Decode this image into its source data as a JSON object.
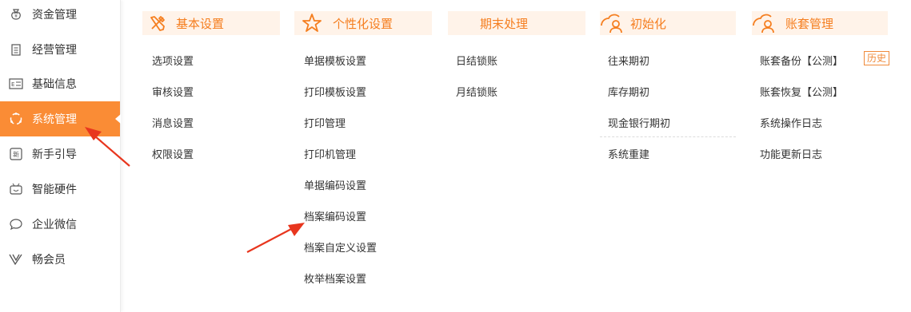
{
  "sidebar": {
    "items": [
      {
        "label": "资金管理",
        "icon": "money-bag-icon"
      },
      {
        "label": "经营管理",
        "icon": "clipboard-icon"
      },
      {
        "label": "基础信息",
        "icon": "id-card-icon"
      },
      {
        "label": "系统管理",
        "icon": "system-cycle-icon"
      },
      {
        "label": "新手引导",
        "icon": "new-badge-icon"
      },
      {
        "label": "智能硬件",
        "icon": "tv-robot-icon"
      },
      {
        "label": "企业微信",
        "icon": "chat-bubble-icon"
      },
      {
        "label": "畅会员",
        "icon": "vip-v-icon"
      }
    ],
    "active_index": 3
  },
  "columns": [
    {
      "title": "基本设置",
      "icon": "tools-icon",
      "items": [
        "选项设置",
        "审核设置",
        "消息设置",
        "权限设置"
      ]
    },
    {
      "title": "个性化设置",
      "icon": "star-icon",
      "items": [
        "单据模板设置",
        "打印模板设置",
        "打印管理",
        "打印机管理",
        "单据编码设置",
        "档案编码设置",
        "档案自定义设置",
        "枚举档案设置"
      ]
    },
    {
      "title": "期末处理",
      "icon": "",
      "items": [
        "日结锁账",
        "月结锁账"
      ]
    },
    {
      "title": "初始化",
      "icon": "cloud-person-icon",
      "items": [
        "往来期初",
        "库存期初",
        "现金银行期初",
        "系统重建"
      ]
    },
    {
      "title": "账套管理",
      "icon": "cloud-person-icon",
      "items": [
        "账套备份【公测】",
        "账套恢复【公测】",
        "系统操作日志",
        "功能更新日志"
      ],
      "badge": "历史"
    }
  ],
  "colors": {
    "accent": "#fa8c35",
    "header_bg": "#fff3e9",
    "header_text": "#f57e1f",
    "arrow": "#e8361e"
  }
}
